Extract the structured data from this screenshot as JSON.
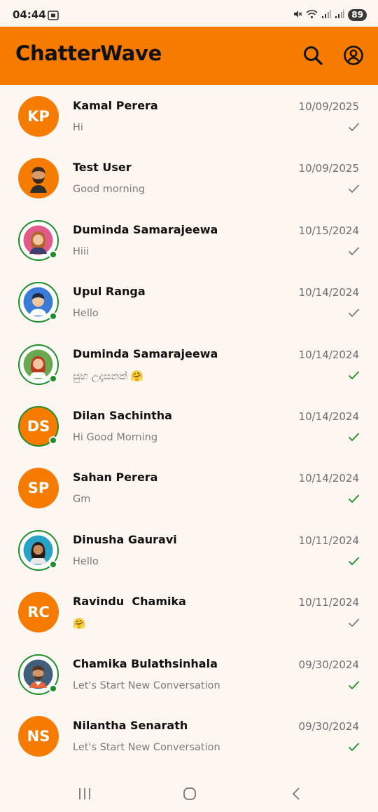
{
  "status_bar": {
    "time": "04:44",
    "battery": "89"
  },
  "app_bar": {
    "title": "ChatterWave"
  },
  "colors": {
    "accent": "#f57c00",
    "online": "#1e8e2a",
    "tick_read": "#1e8e2a",
    "tick_sent": "#7c7c7c"
  },
  "chats": [
    {
      "name": "Kamal Perera",
      "preview": "Hi",
      "date": "10/09/2025",
      "initials": "KP",
      "read": false,
      "online": false
    },
    {
      "name": "Test User",
      "preview": "Good morning",
      "date": "10/09/2025",
      "avatar_icon": "man-beard-avatar-icon",
      "read": false,
      "online": false
    },
    {
      "name": "Duminda Samarajeewa",
      "preview": "Hiii",
      "date": "10/15/2024",
      "avatar_icon": "woman-avatar-icon",
      "read": false,
      "online": true
    },
    {
      "name": "Upul Ranga",
      "preview": "Hello",
      "date": "10/14/2024",
      "avatar_icon": "boy-avatar-icon",
      "read": false,
      "online": true
    },
    {
      "name": "Duminda Samarajeewa",
      "preview": "සුභ උදෑසනක් 🤗",
      "date": "10/14/2024",
      "avatar_icon": "woman-red-hair-avatar-icon",
      "read": true,
      "online": true
    },
    {
      "name": "Dilan Sachintha",
      "preview": "Hi Good Morning",
      "date": "10/14/2024",
      "initials": "DS",
      "read": true,
      "online": true
    },
    {
      "name": "Sahan Perera",
      "preview": "Gm",
      "date": "10/14/2024",
      "initials": "SP",
      "read": true,
      "online": false
    },
    {
      "name": "Dinusha Gauravi",
      "preview": "Hello",
      "date": "10/11/2024",
      "avatar_icon": "woman-dark-hair-avatar-icon",
      "read": true,
      "online": true
    },
    {
      "name": "Ravindu  Chamika",
      "preview": "🤗",
      "date": "10/11/2024",
      "initials": "RC",
      "read": false,
      "online": false
    },
    {
      "name": "Chamika Bulathsinhala",
      "preview": "Let's Start New Conversation",
      "date": "09/30/2024",
      "avatar_icon": "man-avatar-icon",
      "read": true,
      "online": true
    },
    {
      "name": "Nilantha Senarath",
      "preview": "Let's Start New Conversation",
      "date": "09/30/2024",
      "initials": "NS",
      "read": true,
      "online": false
    }
  ]
}
